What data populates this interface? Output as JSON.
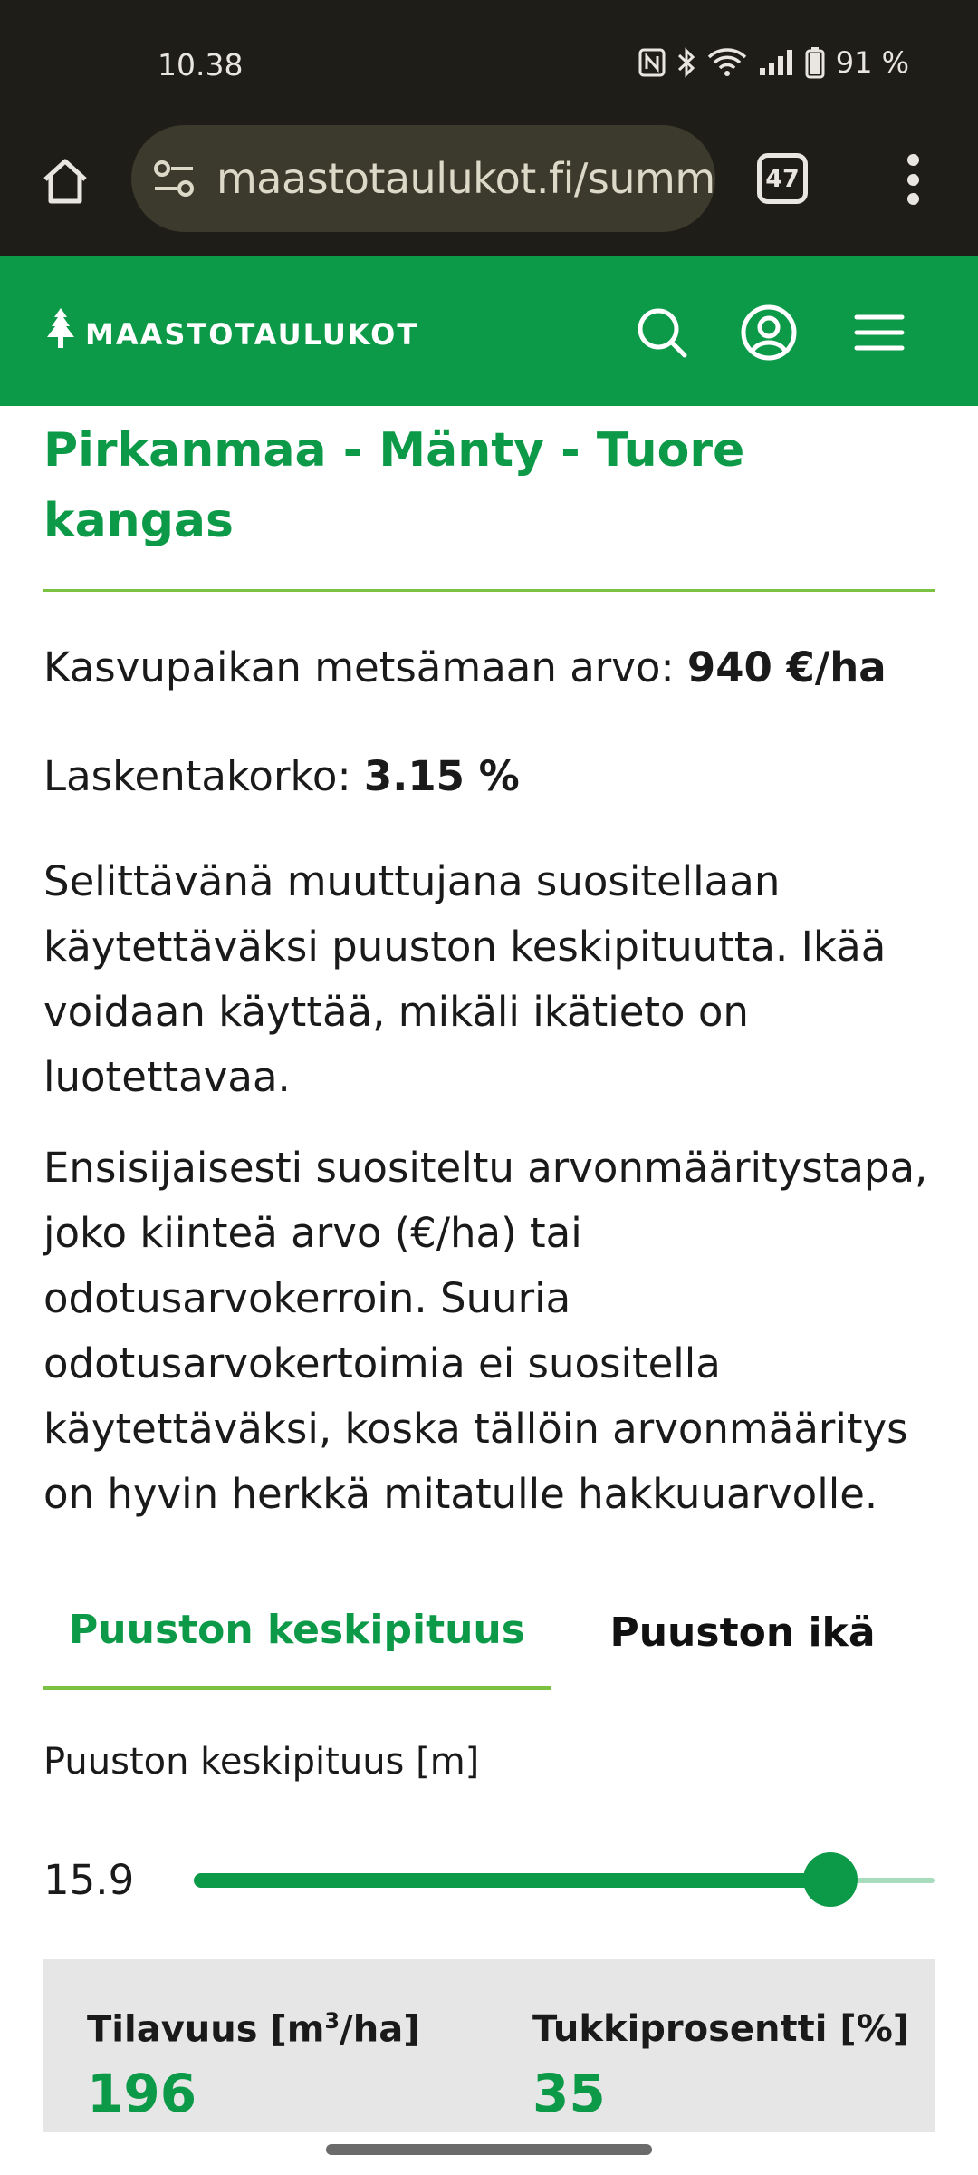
{
  "status_bar": {
    "time": "10.38",
    "battery": "91 %",
    "icons": [
      "nfc-icon",
      "bluetooth-icon",
      "wifi-icon",
      "signal-icon",
      "battery-icon"
    ]
  },
  "browser": {
    "url": "maastotaulukot.fi/summa",
    "tab_count": "47"
  },
  "site": {
    "logo_text": "MAASTOTAULUKOT",
    "brand_color": "#0c9a48",
    "accent_color": "#7cc242"
  },
  "page": {
    "title": "Pirkanmaa - Mänty - Tuore kangas",
    "value_label": "Kasvupaikan metsämaan arvo: ",
    "value": "940 €/ha",
    "rate_label": "Laskentakorko: ",
    "rate": "3.15 %",
    "paragraph1": "Selittävänä muuttujana suositellaan käytettäväksi puuston keskipituutta. Ikää voidaan käyttää, mikäli ikätieto on luotettavaa.",
    "paragraph2": "Ensisijaisesti suositeltu arvonmääritystapa, joko kiinteä arvo (€/ha) tai odotusarvokerroin. Suuria odotusarvokertoimia ei suositella käytettäväksi, koska tällöin arvonmääritys on hyvin herkkä mitatulle hakkuuarvolle."
  },
  "tabs": [
    {
      "label": "Puuston keskipituus",
      "active": true
    },
    {
      "label": "Puuston ikä",
      "active": false
    }
  ],
  "slider": {
    "label": "Puuston keskipituus [m]",
    "value": "15.9",
    "fraction": 0.86
  },
  "stats": {
    "volume_label": "Tilavuus [m",
    "volume_sup": "3",
    "volume_label_end": "/ha]",
    "volume_value": "196",
    "log_label": "Tukkiprosentti [%]",
    "log_value": "35"
  }
}
